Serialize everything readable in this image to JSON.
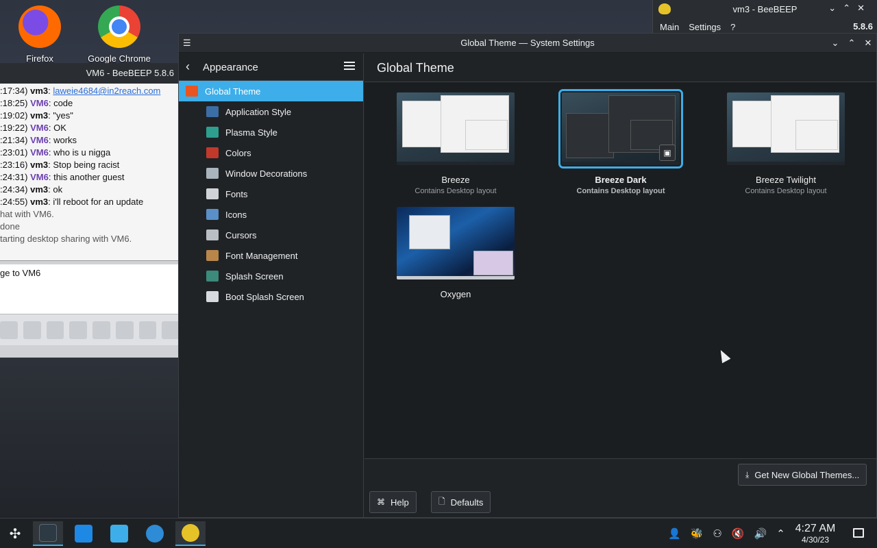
{
  "desktop": {
    "icons": [
      {
        "label": "Firefox",
        "icon": "firefox-icon"
      },
      {
        "label": "Google Chrome",
        "icon": "chrome-icon"
      }
    ]
  },
  "bee_vm3": {
    "title": "vm3 - BeeBEEP",
    "menu": [
      "Main",
      "Settings",
      "?"
    ],
    "version": "5.8.6"
  },
  "bee_vm6": {
    "title": "VM6 - BeeBEEP 5.8.6",
    "chat": [
      {
        "time": ":17:34)",
        "who": "vm3",
        "msg": "",
        "link": "laweie4684@in2reach.com"
      },
      {
        "time": ":18:25)",
        "who": "VM6",
        "msg": "code"
      },
      {
        "time": ":19:02)",
        "who": "vm3",
        "msg": "\"yes\""
      },
      {
        "time": ":19:22)",
        "who": "VM6",
        "msg": "OK"
      },
      {
        "time": ":21:34)",
        "who": "VM6",
        "msg": "works"
      },
      {
        "time": ":23:01)",
        "who": "VM6",
        "msg": "who is u nigga"
      },
      {
        "time": ":23:16)",
        "who": "vm3",
        "msg": "Stop being racist"
      },
      {
        "time": ":24:31)",
        "who": "VM6",
        "msg": "this another guest"
      },
      {
        "time": ":24:34)",
        "who": "vm3",
        "msg": "ok"
      },
      {
        "time": ":24:55)",
        "who": "vm3",
        "msg": "i'll reboot for an update"
      }
    ],
    "system_lines": [
      "hat with VM6.",
      " done",
      "tarting desktop sharing with VM6."
    ],
    "input_text": "ge to VM6"
  },
  "settings": {
    "window_title": "Global Theme — System Settings",
    "sidebar": {
      "header": "Appearance",
      "items": [
        {
          "label": "Global Theme",
          "icon": "global-theme-icon",
          "active": true,
          "top": true
        },
        {
          "label": "Application Style",
          "icon": "application-style-icon"
        },
        {
          "label": "Plasma Style",
          "icon": "plasma-style-icon"
        },
        {
          "label": "Colors",
          "icon": "colors-icon"
        },
        {
          "label": "Window Decorations",
          "icon": "window-decorations-icon"
        },
        {
          "label": "Fonts",
          "icon": "fonts-icon"
        },
        {
          "label": "Icons",
          "icon": "icons-icon"
        },
        {
          "label": "Cursors",
          "icon": "cursors-icon"
        },
        {
          "label": "Font Management",
          "icon": "font-management-icon"
        },
        {
          "label": "Splash Screen",
          "icon": "splash-screen-icon"
        },
        {
          "label": "Boot Splash Screen",
          "icon": "boot-splash-screen-icon"
        }
      ]
    },
    "main_title": "Global Theme",
    "themes": [
      {
        "name": "Breeze",
        "desc": "Contains Desktop layout",
        "selected": false
      },
      {
        "name": "Breeze Dark",
        "desc": "Contains Desktop layout",
        "selected": true
      },
      {
        "name": "Breeze Twilight",
        "desc": "Contains Desktop layout",
        "selected": false
      },
      {
        "name": "Oxygen",
        "desc": "",
        "selected": false
      }
    ],
    "buttons": {
      "get_new": "Get New Global Themes...",
      "help": "Help",
      "defaults": "Defaults"
    }
  },
  "taskbar": {
    "clock_time": "4:27 AM",
    "clock_date": "4/30/23"
  },
  "colors": {
    "accent": "#3daee9",
    "panel": "#202326",
    "content": "#1b1e20"
  }
}
